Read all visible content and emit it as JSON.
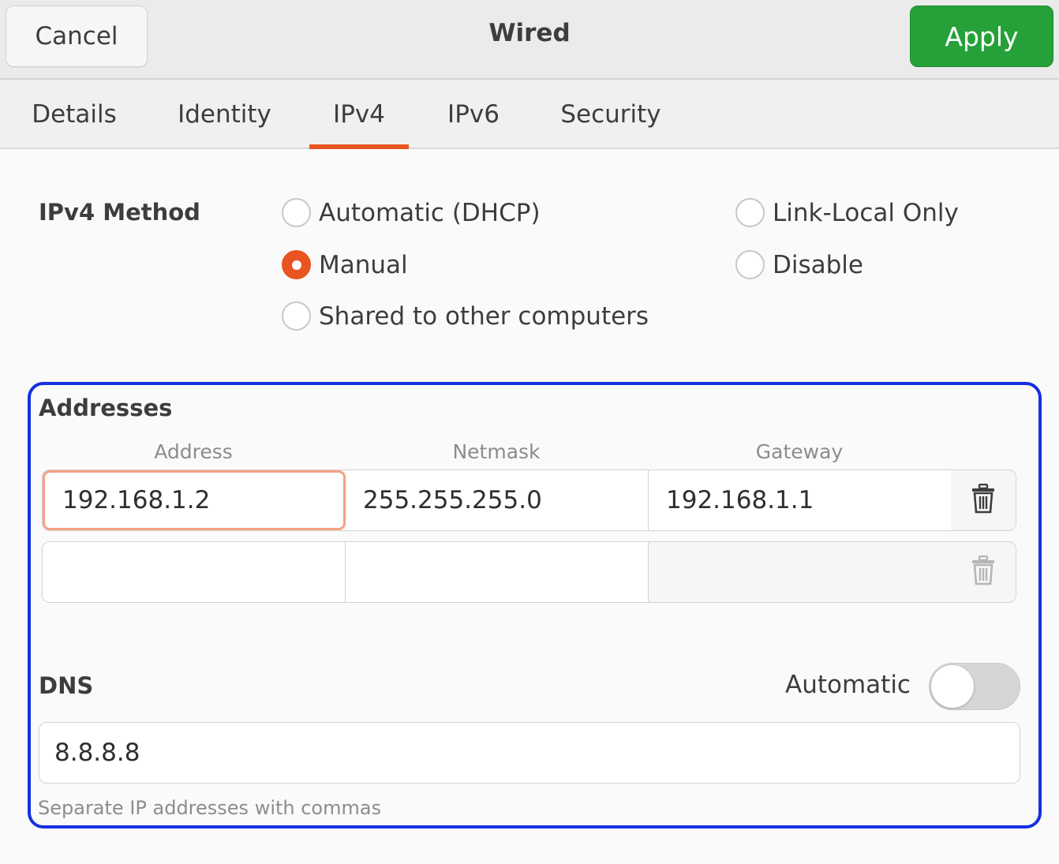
{
  "header": {
    "cancel_label": "Cancel",
    "title": "Wired",
    "apply_label": "Apply"
  },
  "tabs": [
    {
      "label": "Details"
    },
    {
      "label": "Identity"
    },
    {
      "label": "IPv4",
      "active": true
    },
    {
      "label": "IPv6"
    },
    {
      "label": "Security"
    }
  ],
  "ipv4_method": {
    "label": "IPv4 Method",
    "options": [
      {
        "label": "Automatic (DHCP)",
        "checked": false
      },
      {
        "label": "Manual",
        "checked": true
      },
      {
        "label": "Shared to other computers",
        "checked": false
      },
      {
        "label": "Link-Local Only",
        "checked": false
      },
      {
        "label": "Disable",
        "checked": false
      }
    ]
  },
  "addresses": {
    "label": "Addresses",
    "columns": [
      "Address",
      "Netmask",
      "Gateway"
    ],
    "rows": [
      {
        "address": "192.168.1.2",
        "netmask": "255.255.255.0",
        "gateway": "192.168.1.1"
      },
      {
        "address": "",
        "netmask": "",
        "gateway": ""
      }
    ]
  },
  "dns": {
    "label": "DNS",
    "automatic_label": "Automatic",
    "automatic_on": false,
    "value": "8.8.8.8",
    "hint": "Separate IP addresses with commas"
  },
  "colors": {
    "accent": "#e95420",
    "apply": "#26a139",
    "highlight_border": "#1530e0"
  },
  "icons": [
    "trash-icon"
  ]
}
